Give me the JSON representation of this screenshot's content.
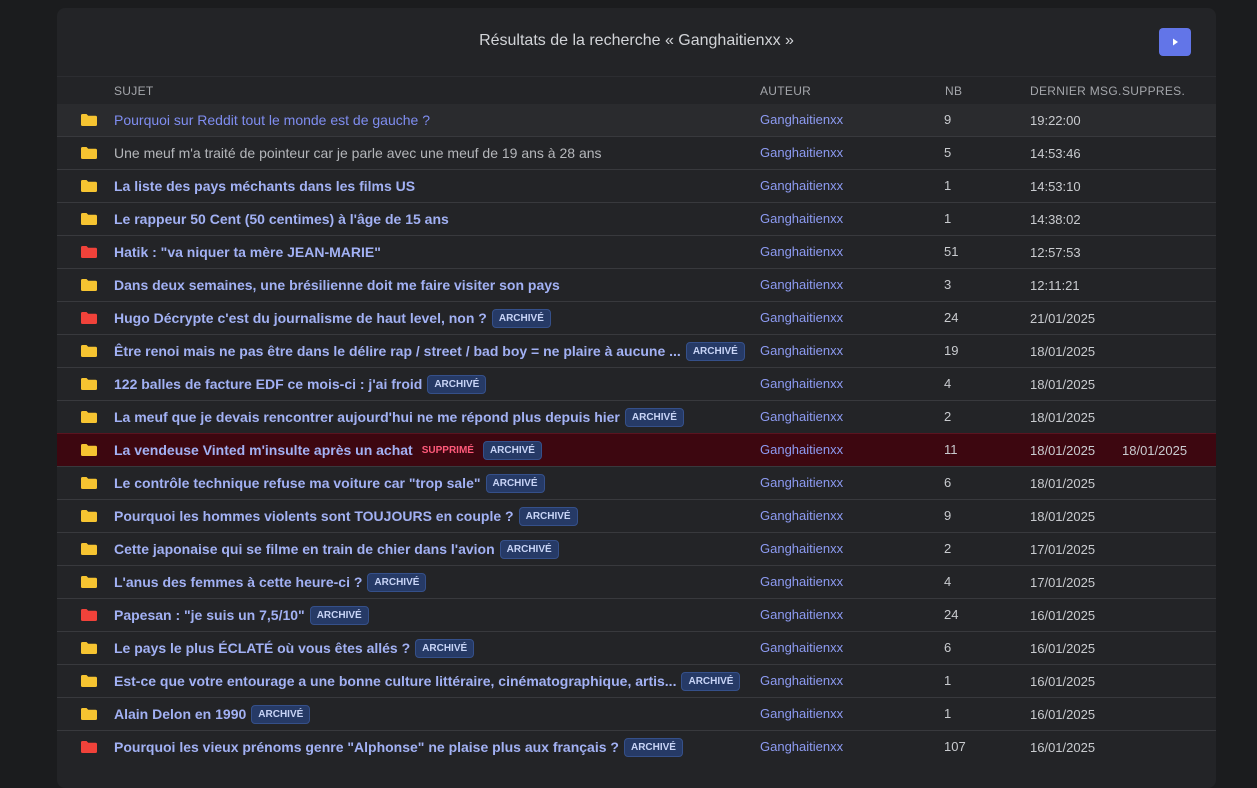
{
  "header": {
    "title": "Résultats de la recherche « Ganghaitienxx »",
    "play_icon": "play-icon"
  },
  "columns": {
    "subject": "SUJET",
    "author": "AUTEUR",
    "nb": "NB",
    "last": "DERNIER MSG.",
    "deleted": "SUPPRES."
  },
  "colors": {
    "folder_yellow": "#f6c431",
    "folder_red": "#f0423a",
    "deleted_row": "#3d0710",
    "accent": "#6275e8"
  },
  "badges": {
    "archive": "ARCHIVÉ",
    "deleted": "SUPPRIMÉ"
  },
  "rows": [
    {
      "subject": "Pourquoi sur Reddit tout le monde est de gauche ?",
      "author": "Ganghaitienxx",
      "nb": "9",
      "last": "19:22:00",
      "deleted_date": "",
      "folder": "yellow",
      "style": "link",
      "archived": false,
      "removed": false
    },
    {
      "subject": "Une meuf m'a traité de pointeur car je parle avec une meuf de 19 ans à 28 ans",
      "author": "Ganghaitienxx",
      "nb": "5",
      "last": "14:53:46",
      "deleted_date": "",
      "folder": "yellow",
      "style": "muted",
      "archived": false,
      "removed": false
    },
    {
      "subject": "La liste des pays méchants dans les films US",
      "author": "Ganghaitienxx",
      "nb": "1",
      "last": "14:53:10",
      "deleted_date": "",
      "folder": "yellow",
      "style": "bold",
      "archived": false,
      "removed": false
    },
    {
      "subject": "Le rappeur 50 Cent (50 centimes) à l'âge de 15 ans",
      "author": "Ganghaitienxx",
      "nb": "1",
      "last": "14:38:02",
      "deleted_date": "",
      "folder": "yellow",
      "style": "bold",
      "archived": false,
      "removed": false
    },
    {
      "subject": "Hatik : \"va niquer ta mère JEAN-MARIE\"",
      "author": "Ganghaitienxx",
      "nb": "51",
      "last": "12:57:53",
      "deleted_date": "",
      "folder": "red",
      "style": "bold",
      "archived": false,
      "removed": false
    },
    {
      "subject": "Dans deux semaines, une brésilienne doit me faire visiter son pays",
      "author": "Ganghaitienxx",
      "nb": "3",
      "last": "12:11:21",
      "deleted_date": "",
      "folder": "yellow",
      "style": "bold",
      "archived": false,
      "removed": false
    },
    {
      "subject": "Hugo Décrypte c'est du journalisme de haut level, non ?",
      "author": "Ganghaitienxx",
      "nb": "24",
      "last": "21/01/2025",
      "deleted_date": "",
      "folder": "red",
      "style": "bold",
      "archived": true,
      "removed": false
    },
    {
      "subject": "Être renoi mais ne pas être dans le délire rap / street / bad boy = ne plaire à aucune ...",
      "author": "Ganghaitienxx",
      "nb": "19",
      "last": "18/01/2025",
      "deleted_date": "",
      "folder": "yellow",
      "style": "bold",
      "archived": true,
      "removed": false
    },
    {
      "subject": "122 balles de facture EDF ce mois-ci : j'ai froid",
      "author": "Ganghaitienxx",
      "nb": "4",
      "last": "18/01/2025",
      "deleted_date": "",
      "folder": "yellow",
      "style": "bold",
      "archived": true,
      "removed": false
    },
    {
      "subject": "La meuf que je devais rencontrer aujourd'hui ne me répond plus depuis hier",
      "author": "Ganghaitienxx",
      "nb": "2",
      "last": "18/01/2025",
      "deleted_date": "",
      "folder": "yellow",
      "style": "bold",
      "archived": true,
      "removed": false
    },
    {
      "subject": "La vendeuse Vinted m'insulte après un achat",
      "author": "Ganghaitienxx",
      "nb": "11",
      "last": "18/01/2025",
      "deleted_date": "18/01/2025",
      "folder": "yellow",
      "style": "bold",
      "archived": true,
      "removed": true
    },
    {
      "subject": "Le contrôle technique refuse ma voiture car \"trop sale\"",
      "author": "Ganghaitienxx",
      "nb": "6",
      "last": "18/01/2025",
      "deleted_date": "",
      "folder": "yellow",
      "style": "bold",
      "archived": true,
      "removed": false
    },
    {
      "subject": "Pourquoi les hommes violents sont TOUJOURS en couple ?",
      "author": "Ganghaitienxx",
      "nb": "9",
      "last": "18/01/2025",
      "deleted_date": "",
      "folder": "yellow",
      "style": "bold",
      "archived": true,
      "removed": false
    },
    {
      "subject": "Cette japonaise qui se filme en train de chier dans l'avion",
      "author": "Ganghaitienxx",
      "nb": "2",
      "last": "17/01/2025",
      "deleted_date": "",
      "folder": "yellow",
      "style": "bold",
      "archived": true,
      "removed": false
    },
    {
      "subject": "L'anus des femmes à cette heure-ci ?",
      "author": "Ganghaitienxx",
      "nb": "4",
      "last": "17/01/2025",
      "deleted_date": "",
      "folder": "yellow",
      "style": "bold",
      "archived": true,
      "removed": false
    },
    {
      "subject": "Papesan : \"je suis un 7,5/10\"",
      "author": "Ganghaitienxx",
      "nb": "24",
      "last": "16/01/2025",
      "deleted_date": "",
      "folder": "red",
      "style": "bold",
      "archived": true,
      "removed": false
    },
    {
      "subject": "Le pays le plus ÉCLATÉ où vous êtes allés ?",
      "author": "Ganghaitienxx",
      "nb": "6",
      "last": "16/01/2025",
      "deleted_date": "",
      "folder": "yellow",
      "style": "bold",
      "archived": true,
      "removed": false
    },
    {
      "subject": "Est-ce que votre entourage a une bonne culture littéraire, cinématographique, artis...",
      "author": "Ganghaitienxx",
      "nb": "1",
      "last": "16/01/2025",
      "deleted_date": "",
      "folder": "yellow",
      "style": "bold",
      "archived": true,
      "removed": false
    },
    {
      "subject": "Alain Delon en 1990",
      "author": "Ganghaitienxx",
      "nb": "1",
      "last": "16/01/2025",
      "deleted_date": "",
      "folder": "yellow",
      "style": "bold",
      "archived": true,
      "removed": false
    },
    {
      "subject": "Pourquoi les vieux prénoms genre \"Alphonse\" ne plaise plus aux français ?",
      "author": "Ganghaitienxx",
      "nb": "107",
      "last": "16/01/2025",
      "deleted_date": "",
      "folder": "red",
      "style": "bold",
      "archived": true,
      "removed": false
    }
  ]
}
